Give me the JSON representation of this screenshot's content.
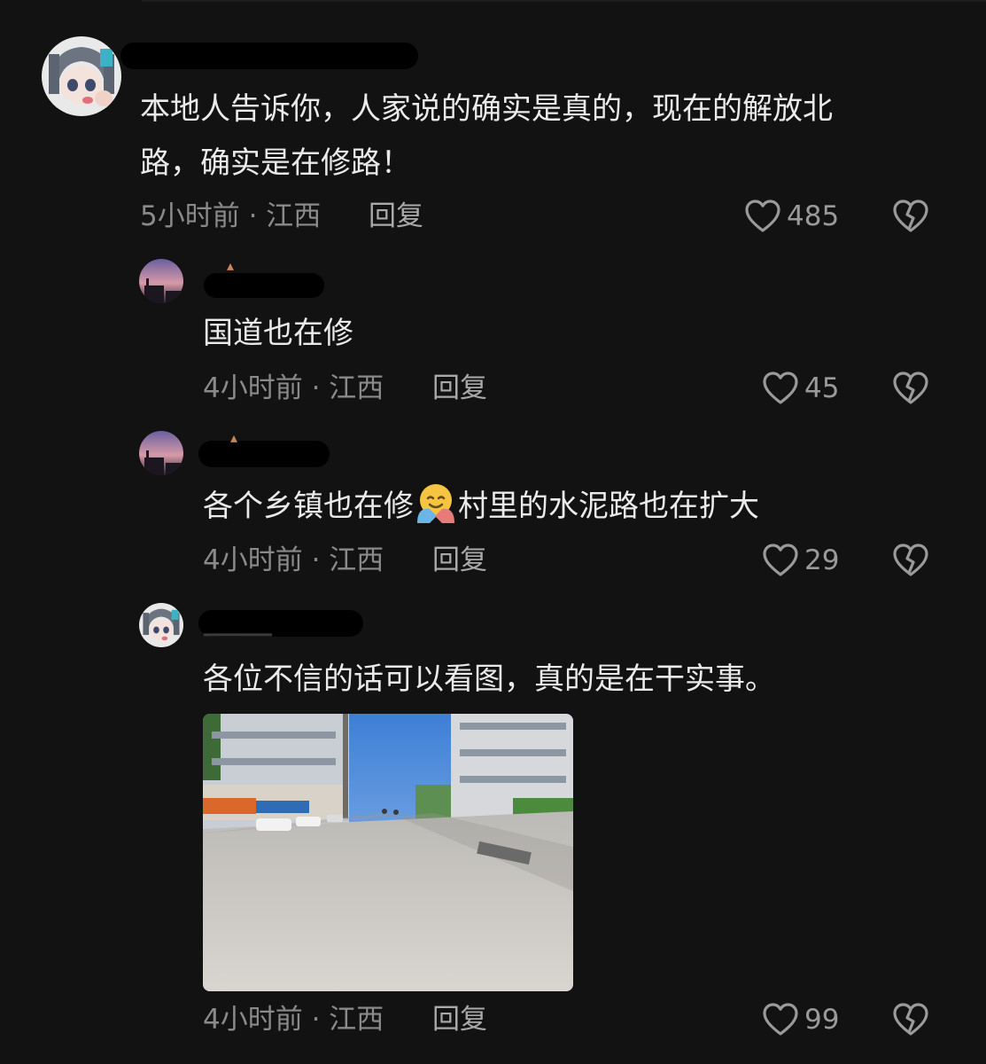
{
  "comments": [
    {
      "text_line1": "本地人告诉你，人家说的确实是真的，现在的解放北",
      "text_line2": "路，确实是在修路！",
      "time_location": "5小时前 · 江西",
      "reply_label": "回复",
      "likes": "485"
    },
    {
      "text": "国道也在修",
      "time_location": "4小时前 · 江西",
      "reply_label": "回复",
      "likes": "45"
    },
    {
      "text_before_emoji": "各个乡镇也在修",
      "emoji": "hugging-face",
      "text_after_emoji": "村里的水泥路也在扩大",
      "time_location": "4小时前 · 江西",
      "reply_label": "回复",
      "likes": "29"
    },
    {
      "text": "各位不信的话可以看图，真的是在干实事。",
      "time_location": "4小时前 · 江西",
      "reply_label": "回复",
      "likes": "99"
    }
  ],
  "icons": {
    "like": "heart-outline-icon",
    "dislike": "broken-heart-icon"
  },
  "colors": {
    "background": "#121212",
    "primary_text": "#eaeaea",
    "secondary_text": "#8a8a8a"
  }
}
